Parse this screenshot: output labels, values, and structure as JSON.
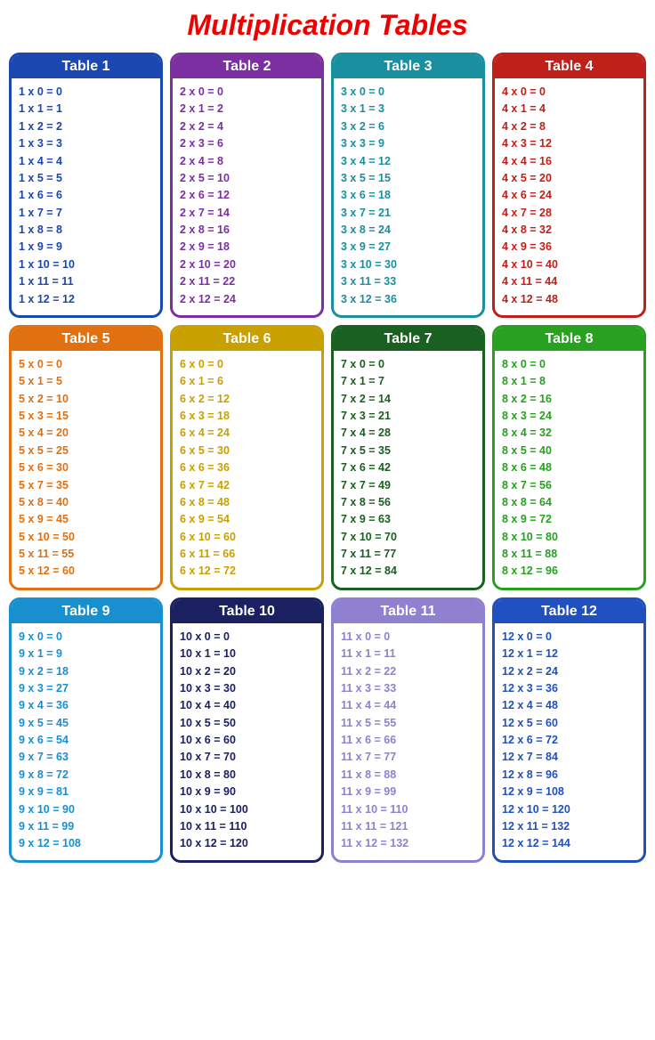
{
  "title": "Multiplication Tables",
  "tables": [
    {
      "id": 1,
      "label": "Table 1",
      "rows": [
        "1 x 0 = 0",
        "1 x 1 = 1",
        "1 x 2 = 2",
        "1 x 3 = 3",
        "1 x 4 = 4",
        "1 x 5 = 5",
        "1 x 6 = 6",
        "1 x 7 = 7",
        "1 x 8 = 8",
        "1 x 9 = 9",
        "1 x 10 = 10",
        "1 x 11 = 11",
        "1 x 12 = 12"
      ]
    },
    {
      "id": 2,
      "label": "Table 2",
      "rows": [
        "2 x 0 = 0",
        "2 x 1 = 2",
        "2 x 2 = 4",
        "2 x 3 = 6",
        "2 x 4 = 8",
        "2 x 5 = 10",
        "2 x 6 = 12",
        "2 x 7 = 14",
        "2 x 8 = 16",
        "2 x 9 = 18",
        "2 x 10 = 20",
        "2 x 11 = 22",
        "2 x 12 = 24"
      ]
    },
    {
      "id": 3,
      "label": "Table 3",
      "rows": [
        "3 x 0 = 0",
        "3 x 1 = 3",
        "3 x 2 = 6",
        "3 x 3 = 9",
        "3 x 4 = 12",
        "3 x 5 = 15",
        "3 x 6 = 18",
        "3 x 7 = 21",
        "3 x 8 = 24",
        "3 x 9 = 27",
        "3 x 10 = 30",
        "3 x 11 = 33",
        "3 x 12 = 36"
      ]
    },
    {
      "id": 4,
      "label": "Table 4",
      "rows": [
        "4 x 0 = 0",
        "4 x 1 = 4",
        "4 x 2 = 8",
        "4 x 3 = 12",
        "4 x 4 = 16",
        "4 x 5 = 20",
        "4 x 6 = 24",
        "4 x 7 = 28",
        "4 x 8 = 32",
        "4 x 9 = 36",
        "4 x 10 = 40",
        "4 x 11 = 44",
        "4 x 12 = 48"
      ]
    },
    {
      "id": 5,
      "label": "Table 5",
      "rows": [
        "5 x 0 = 0",
        "5 x 1 = 5",
        "5 x 2 = 10",
        "5 x 3 = 15",
        "5 x 4 = 20",
        "5 x 5 = 25",
        "5 x 6 = 30",
        "5 x 7 = 35",
        "5 x 8 = 40",
        "5 x 9 = 45",
        "5 x 10 = 50",
        "5 x 11 = 55",
        "5 x 12 = 60"
      ]
    },
    {
      "id": 6,
      "label": "Table 6",
      "rows": [
        "6 x 0 = 0",
        "6 x 1 = 6",
        "6 x 2 = 12",
        "6 x 3 = 18",
        "6 x 4 = 24",
        "6 x 5 = 30",
        "6 x 6 = 36",
        "6 x 7 = 42",
        "6 x 8 = 48",
        "6 x 9 = 54",
        "6 x 10 = 60",
        "6 x 11 = 66",
        "6 x 12 = 72"
      ]
    },
    {
      "id": 7,
      "label": "Table 7",
      "rows": [
        "7 x 0 = 0",
        "7 x 1 = 7",
        "7 x 2 = 14",
        "7 x 3 = 21",
        "7 x 4 = 28",
        "7 x 5 = 35",
        "7 x 6 = 42",
        "7 x 7 = 49",
        "7 x 8 = 56",
        "7 x 9 = 63",
        "7 x 10 = 70",
        "7 x 11 = 77",
        "7 x 12 = 84"
      ]
    },
    {
      "id": 8,
      "label": "Table 8",
      "rows": [
        "8 x 0 = 0",
        "8 x 1 = 8",
        "8 x 2 = 16",
        "8 x 3 = 24",
        "8 x 4 = 32",
        "8 x 5 = 40",
        "8 x 6 = 48",
        "8 x 7 = 56",
        "8 x 8 = 64",
        "8 x 9 = 72",
        "8 x 10 = 80",
        "8 x 11 = 88",
        "8 x 12 = 96"
      ]
    },
    {
      "id": 9,
      "label": "Table 9",
      "rows": [
        "9 x 0 = 0",
        "9 x 1 = 9",
        "9 x 2 = 18",
        "9 x 3 = 27",
        "9 x 4 = 36",
        "9 x 5 = 45",
        "9 x 6 = 54",
        "9 x 7 = 63",
        "9 x 8 = 72",
        "9 x 9 = 81",
        "9 x 10 = 90",
        "9 x 11 = 99",
        "9 x 12 = 108"
      ]
    },
    {
      "id": 10,
      "label": "Table 10",
      "rows": [
        "10 x 0 = 0",
        "10 x 1 = 10",
        "10 x 2 = 20",
        "10 x 3 = 30",
        "10 x 4 = 40",
        "10 x 5 = 50",
        "10 x 6 = 60",
        "10 x 7 = 70",
        "10 x 8 = 80",
        "10 x 9 = 90",
        "10 x 10 = 100",
        "10 x 11 = 110",
        "10 x 12 = 120"
      ]
    },
    {
      "id": 11,
      "label": "Table 11",
      "rows": [
        "11 x 0 = 0",
        "11 x 1 = 11",
        "11 x 2 = 22",
        "11 x 3 = 33",
        "11 x 4 = 44",
        "11 x 5 = 55",
        "11 x 6 = 66",
        "11 x 7 = 77",
        "11 x 8 = 88",
        "11 x 9 = 99",
        "11 x 10 = 110",
        "11 x 11 = 121",
        "11 x 12 = 132"
      ]
    },
    {
      "id": 12,
      "label": "Table 12",
      "rows": [
        "12 x 0 = 0",
        "12 x 1 = 12",
        "12 x 2 = 24",
        "12 x 3 = 36",
        "12 x 4 = 48",
        "12 x 5 = 60",
        "12 x 6 = 72",
        "12 x 7 = 84",
        "12 x 8 = 96",
        "12 x 9 = 108",
        "12 x 10 = 120",
        "12 x 11 = 132",
        "12 x 12 = 144"
      ]
    }
  ]
}
